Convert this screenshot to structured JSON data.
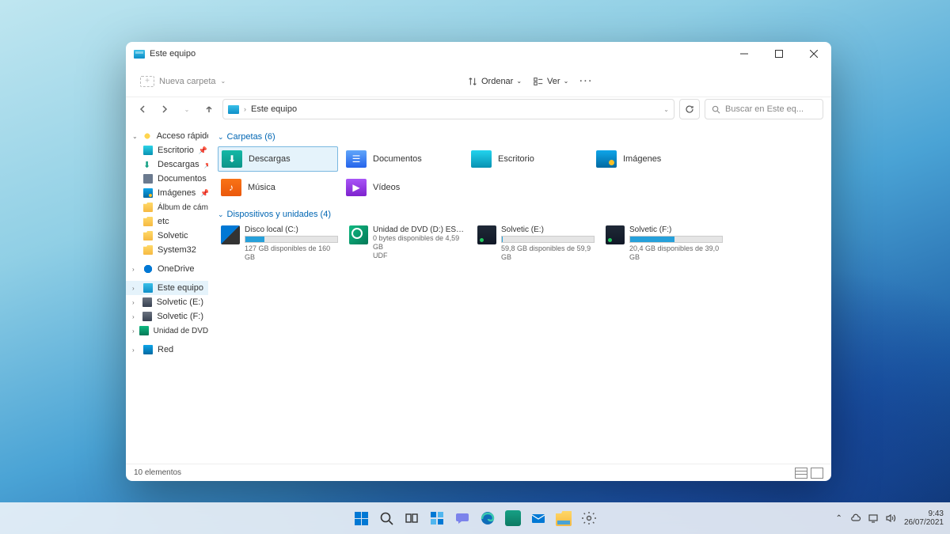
{
  "window": {
    "title": "Este equipo"
  },
  "toolbar": {
    "new_folder": "Nueva carpeta",
    "sort": "Ordenar",
    "view": "Ver"
  },
  "address": {
    "path": "Este equipo"
  },
  "search": {
    "placeholder": "Buscar en Este eq..."
  },
  "sidebar": {
    "quick_access": "Acceso rápido",
    "items": [
      "Escritorio",
      "Descargas",
      "Documentos",
      "Imágenes",
      "Álbum de cámara",
      "etc",
      "Solvetic",
      "System32"
    ],
    "onedrive": "OneDrive",
    "thispc": "Este equipo",
    "drives": [
      "Solvetic (E:)",
      "Solvetic (F:)",
      "Unidad de DVD (D:)"
    ],
    "network": "Red"
  },
  "groups": {
    "folders": {
      "title": "Carpetas (6)",
      "items": [
        "Descargas",
        "Documentos",
        "Escritorio",
        "Imágenes",
        "Música",
        "Vídeos"
      ]
    },
    "devices": {
      "title": "Dispositivos y unidades (4)",
      "items": [
        {
          "name": "Disco local (C:)",
          "sub": "127 GB disponibles de 160 GB",
          "fill": 21
        },
        {
          "name": "Unidad de DVD (D:) ESD-ISO",
          "sub": "0 bytes disponibles de 4,59 GB",
          "sub2": "UDF",
          "fill": 0
        },
        {
          "name": "Solvetic (E:)",
          "sub": "59,8 GB disponibles de 59,9 GB",
          "fill": 1
        },
        {
          "name": "Solvetic (F:)",
          "sub": "20,4 GB disponibles de 39,0 GB",
          "fill": 48
        }
      ]
    }
  },
  "status": {
    "count": "10 elementos"
  },
  "tray": {
    "time": "9:43",
    "date": "26/07/2021"
  }
}
